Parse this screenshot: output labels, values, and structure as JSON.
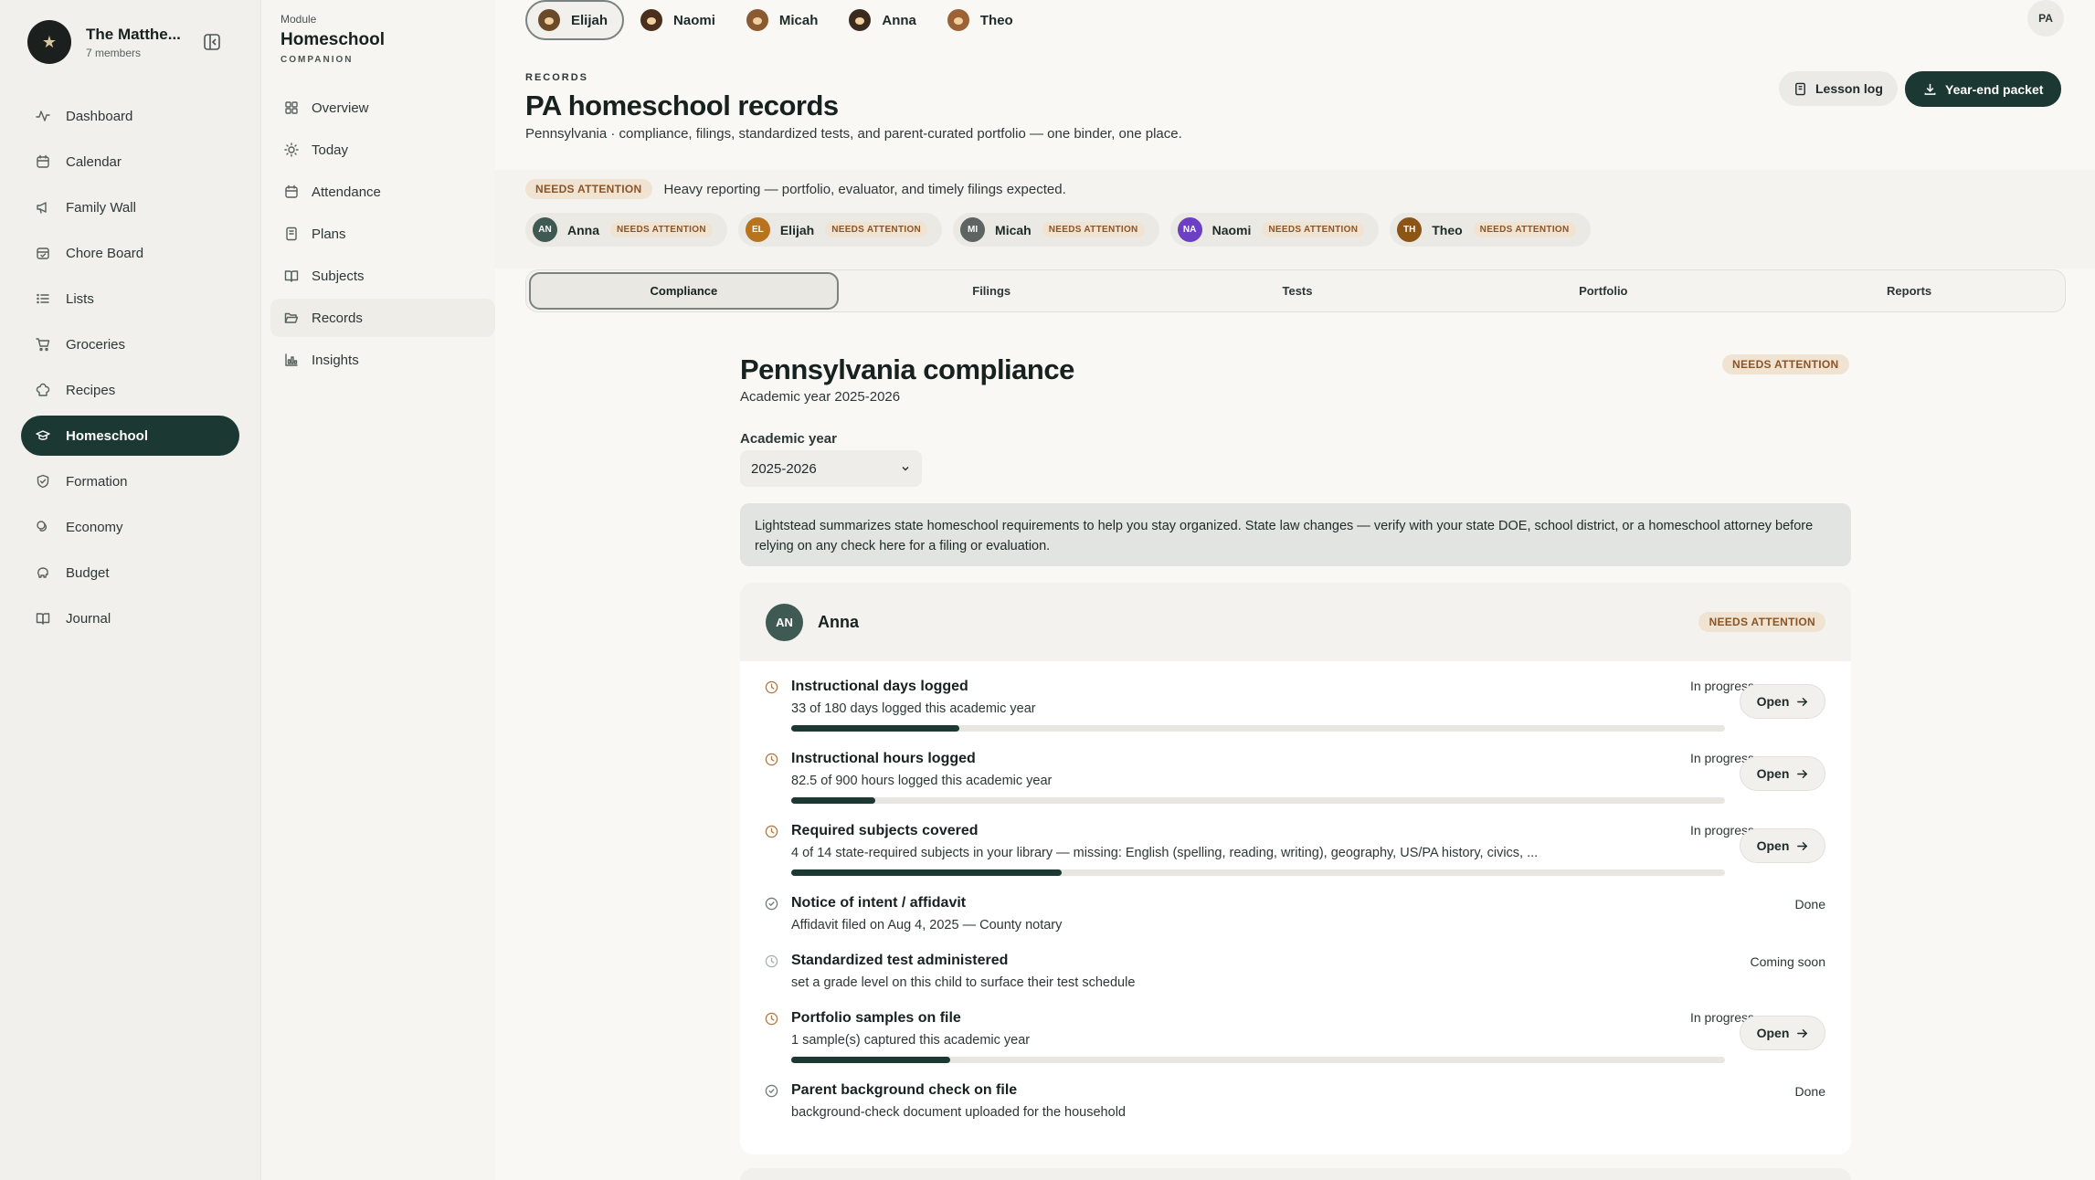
{
  "household": {
    "name": "The Matthe...",
    "members": "7 members"
  },
  "nav": [
    {
      "label": "Dashboard",
      "icon": "activity-icon"
    },
    {
      "label": "Calendar",
      "icon": "calendar-icon"
    },
    {
      "label": "Family Wall",
      "icon": "megaphone-icon"
    },
    {
      "label": "Chore Board",
      "icon": "calendar-check-icon"
    },
    {
      "label": "Lists",
      "icon": "list-icon"
    },
    {
      "label": "Groceries",
      "icon": "cart-icon"
    },
    {
      "label": "Recipes",
      "icon": "chef-hat-icon"
    },
    {
      "label": "Homeschool",
      "icon": "graduation-cap-icon",
      "active": true
    },
    {
      "label": "Formation",
      "icon": "shield-icon"
    },
    {
      "label": "Economy",
      "icon": "coins-icon"
    },
    {
      "label": "Budget",
      "icon": "piggy-bank-icon"
    },
    {
      "label": "Journal",
      "icon": "book-open-icon"
    }
  ],
  "module": {
    "label": "Module",
    "title": "Homeschool",
    "tag": "COMPANION",
    "items": [
      {
        "label": "Overview",
        "icon": "grid-icon"
      },
      {
        "label": "Today",
        "icon": "sun-icon"
      },
      {
        "label": "Attendance",
        "icon": "calendar-icon"
      },
      {
        "label": "Plans",
        "icon": "notebook-icon"
      },
      {
        "label": "Subjects",
        "icon": "book-icon"
      },
      {
        "label": "Records",
        "icon": "folder-open-icon",
        "active": true
      },
      {
        "label": "Insights",
        "icon": "bar-chart-icon"
      }
    ]
  },
  "children_tabs": [
    {
      "name": "Elijah",
      "active": true,
      "hair": "#6b4a2a"
    },
    {
      "name": "Naomi",
      "hair": "#4a2f1c"
    },
    {
      "name": "Micah",
      "hair": "#8a5a30"
    },
    {
      "name": "Anna",
      "hair": "#3b2a1e"
    },
    {
      "name": "Theo",
      "hair": "#9a6235"
    }
  ],
  "user": {
    "initials": "PA"
  },
  "header": {
    "eyebrow": "RECORDS",
    "title": "PA homeschool records",
    "subtitle": "Pennsylvania · compliance, filings, standardized tests, and parent-curated portfolio — one binder, one place.",
    "lesson_log": "Lesson log",
    "year_end_packet": "Year-end packet"
  },
  "status": {
    "pill": "NEEDS ATTENTION",
    "text": "Heavy reporting — portfolio, evaluator, and timely filings expected."
  },
  "kids": [
    {
      "initials": "AN",
      "name": "Anna",
      "status": "NEEDS ATTENTION",
      "color": "#3f5a53"
    },
    {
      "initials": "EL",
      "name": "Elijah",
      "status": "NEEDS ATTENTION",
      "color": "#b8731f"
    },
    {
      "initials": "MI",
      "name": "Micah",
      "status": "NEEDS ATTENTION",
      "color": "#5d6462"
    },
    {
      "initials": "NA",
      "name": "Naomi",
      "status": "NEEDS ATTENTION",
      "color": "#6d3fc4"
    },
    {
      "initials": "TH",
      "name": "Theo",
      "status": "NEEDS ATTENTION",
      "color": "#8c5516"
    }
  ],
  "tabs": [
    {
      "label": "Compliance",
      "active": true
    },
    {
      "label": "Filings"
    },
    {
      "label": "Tests"
    },
    {
      "label": "Portfolio"
    },
    {
      "label": "Reports"
    }
  ],
  "compliance": {
    "title": "Pennsylvania compliance",
    "subtitle": "Academic year 2025-2026",
    "status": "NEEDS ATTENTION",
    "year_label": "Academic year",
    "year_value": "2025-2026",
    "notice": "Lightstead summarizes state homeschool requirements to help you stay organized. State law changes — verify with your state DOE, school district, or a homeschool attorney before relying on any check here for a filing or evaluation."
  },
  "student_card": {
    "initials": "AN",
    "name": "Anna",
    "status": "NEEDS ATTENTION",
    "open_label": "Open",
    "requirements": [
      {
        "title": "Instructional days logged",
        "desc": "33 of 180 days logged this academic year",
        "state": "In progress",
        "progress": 0.18,
        "open": true,
        "kind": "progress"
      },
      {
        "title": "Instructional hours logged",
        "desc": "82.5 of 900 hours logged this academic year",
        "state": "In progress",
        "progress": 0.09,
        "open": true,
        "kind": "progress"
      },
      {
        "title": "Required subjects covered",
        "desc": "4 of 14 state-required subjects in your library — missing: English (spelling, reading, writing), geography, US/PA history, civics, ...",
        "state": "In progress",
        "progress": 0.29,
        "open": true,
        "kind": "progress"
      },
      {
        "title": "Notice of intent / affidavit",
        "desc": "Affidavit filed on Aug 4, 2025 — County notary",
        "state": "Done",
        "kind": "done"
      },
      {
        "title": "Standardized test administered",
        "desc": "set a grade level on this child to surface their test schedule",
        "state": "Coming soon",
        "kind": "soon"
      },
      {
        "title": "Portfolio samples on file",
        "desc": "1 sample(s) captured this academic year",
        "state": "In progress",
        "progress": 0.17,
        "open": true,
        "kind": "progress"
      },
      {
        "title": "Parent background check on file",
        "desc": "background-check document uploaded for the household",
        "state": "Done",
        "kind": "done"
      }
    ]
  }
}
